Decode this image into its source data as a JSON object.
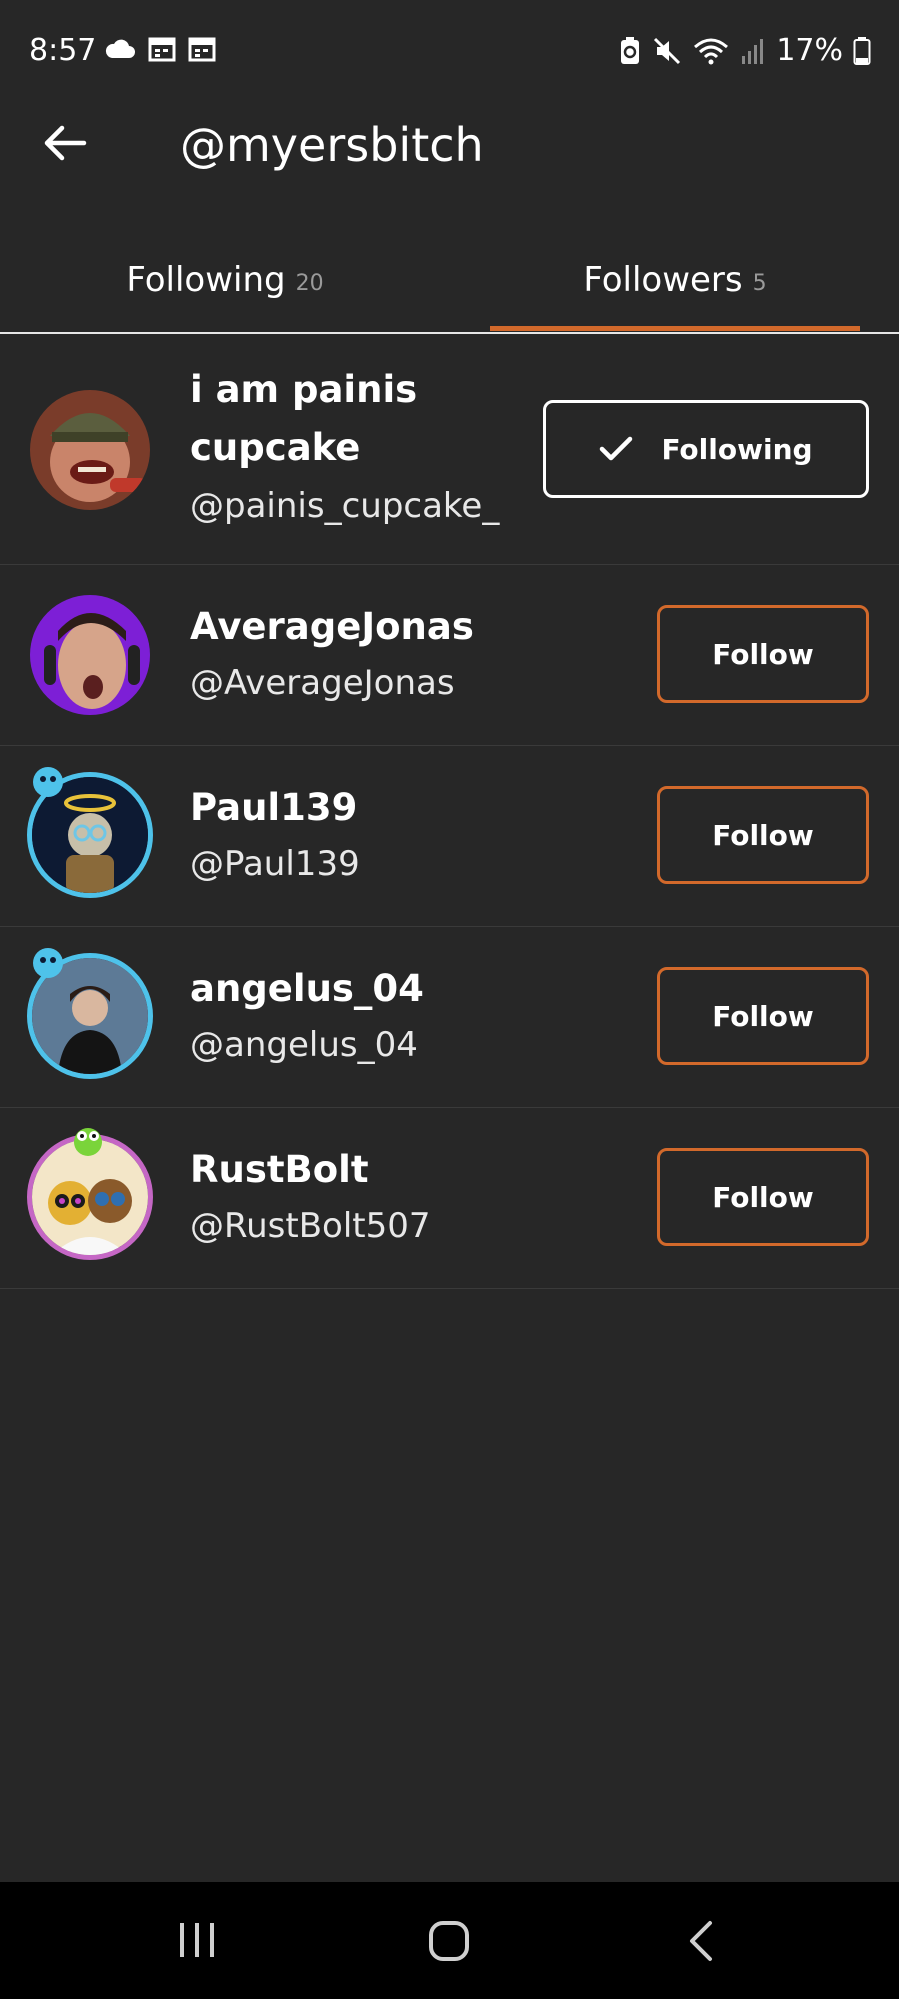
{
  "status": {
    "time": "8:57",
    "battery": "17%",
    "left_icons": [
      "cloud-icon",
      "calendar-icon",
      "calendar-icon"
    ],
    "right_icons": [
      "battery-saver-icon",
      "mute-icon",
      "wifi-icon",
      "signal-icon",
      "battery-icon"
    ]
  },
  "header": {
    "title": "@myersbitch",
    "back_icon": "arrow-left-icon"
  },
  "tabs": [
    {
      "label": "Following",
      "count": "20",
      "active": false
    },
    {
      "label": "Followers",
      "count": "5",
      "active": true
    }
  ],
  "followers": [
    {
      "name_line1": "i am painis",
      "name_line2": "cupcake",
      "handle": "@painis_cupcake_",
      "button": "Following",
      "following": true
    },
    {
      "name": "AverageJonas",
      "handle": "@AverageJonas",
      "button": "Follow",
      "following": false
    },
    {
      "name": "Paul139",
      "handle": "@Paul139",
      "button": "Follow",
      "following": false
    },
    {
      "name": "angelus_04",
      "handle": "@angelus_04",
      "button": "Follow",
      "following": false
    },
    {
      "name": "RustBolt",
      "handle": "@RustBolt507",
      "button": "Follow",
      "following": false
    }
  ],
  "colors": {
    "background": "#272727",
    "accent": "#d2692b",
    "ring_blue": "#4ec2ea",
    "ring_pink": "#c567c5"
  },
  "navbar": {
    "items": [
      "recent-apps-icon",
      "home-icon",
      "back-icon"
    ]
  }
}
